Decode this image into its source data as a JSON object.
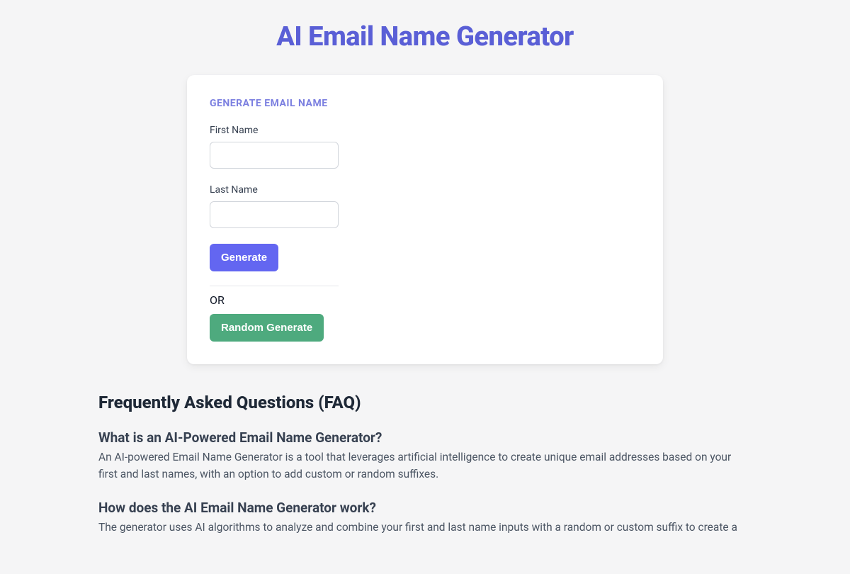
{
  "page": {
    "title": "AI Email Name Generator"
  },
  "form": {
    "heading": "GENERATE EMAIL NAME",
    "first_name_label": "First Name",
    "first_name_value": "",
    "last_name_label": "Last Name",
    "last_name_value": "",
    "generate_label": "Generate",
    "or_text": "OR",
    "random_label": "Random Generate"
  },
  "faq": {
    "title": "Frequently Asked Questions (FAQ)",
    "items": [
      {
        "q": "What is an AI-Powered Email Name Generator?",
        "a": "An AI-powered Email Name Generator is a tool that leverages artificial intelligence to create unique email addresses based on your first and last names, with an option to add custom or random suffixes."
      },
      {
        "q": "How does the AI Email Name Generator work?",
        "a": "The generator uses AI algorithms to analyze and combine your first and last name inputs with a random or custom suffix to create a"
      }
    ]
  }
}
